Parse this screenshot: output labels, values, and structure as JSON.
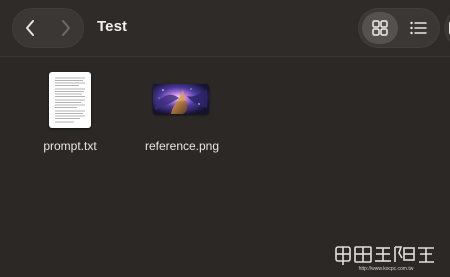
{
  "window": {
    "title": "Test"
  },
  "toolbar": {
    "back_icon": "chevron-left-icon",
    "forward_icon": "chevron-right-icon",
    "grid_view_icon": "grid-icon",
    "list_view_icon": "list-icon"
  },
  "files": [
    {
      "name": "prompt.txt",
      "kind": "text-document",
      "icon": "text-document-icon"
    },
    {
      "name": "reference.png",
      "kind": "image",
      "icon": "image-thumbnail"
    }
  ],
  "watermark": {
    "text": "電腦王阿達",
    "url": "http://www.kocpc.com.tw"
  },
  "colors": {
    "window_background": "#2b2825",
    "toolbar_background": "#2e2b29",
    "button_group": "#3a3734",
    "selected_view": "#55514d",
    "text": "#e9e6e3"
  }
}
